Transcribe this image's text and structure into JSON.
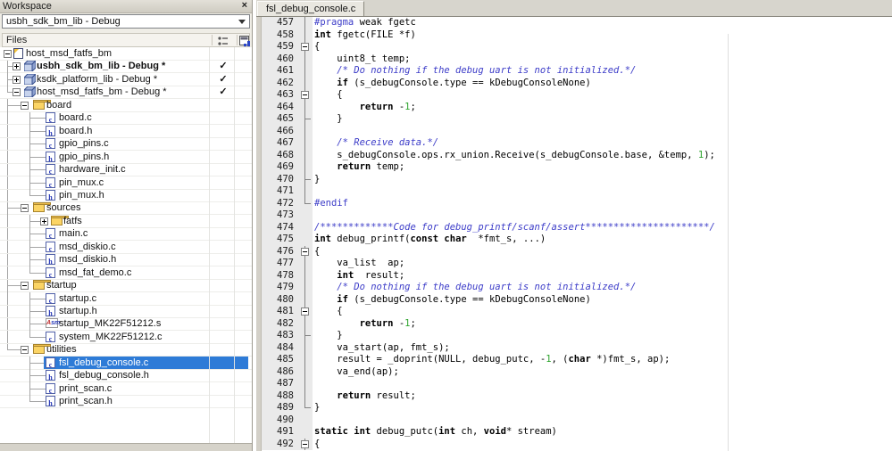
{
  "workspace": {
    "title": "Workspace",
    "close_label": "×",
    "config_selector": "usbh_sdk_bm_lib - Debug",
    "files_header": "Files",
    "header_icons": [
      "option-overrides-icon",
      "output-column-icon"
    ],
    "tree": [
      {
        "t": "root",
        "exp": "-",
        "icon": "root",
        "label": "host_msd_fatfs_bm"
      },
      {
        "t": "proj",
        "conn": "tee",
        "exp": "+",
        "icon": "proj",
        "label": "usbh_sdk_bm_lib - Debug *",
        "bold": true,
        "check": true
      },
      {
        "t": "proj",
        "conn": "tee",
        "exp": "+",
        "icon": "proj",
        "label": "ksdk_platform_lib - Debug *",
        "check": true
      },
      {
        "t": "proj",
        "conn": "elbow",
        "exp": "-",
        "icon": "proj",
        "label": "host_msd_fatfs_bm - Debug *",
        "check": true
      },
      {
        "t": "folder",
        "conn": "tee",
        "exp": "-",
        "icon": "folder",
        "label": "board"
      },
      {
        "t": "file",
        "conn": "tee",
        "g8": true,
        "icon": "c",
        "label": "board.c"
      },
      {
        "t": "file",
        "conn": "tee",
        "g8": true,
        "icon": "h",
        "label": "board.h"
      },
      {
        "t": "file",
        "conn": "tee",
        "g8": true,
        "icon": "c",
        "label": "gpio_pins.c"
      },
      {
        "t": "file",
        "conn": "tee",
        "g8": true,
        "icon": "h",
        "label": "gpio_pins.h"
      },
      {
        "t": "file",
        "conn": "tee",
        "g8": true,
        "icon": "c",
        "label": "hardware_init.c"
      },
      {
        "t": "file",
        "conn": "tee",
        "g8": true,
        "icon": "c",
        "label": "pin_mux.c"
      },
      {
        "t": "file",
        "conn": "elbow",
        "g8": true,
        "icon": "h",
        "label": "pin_mux.h"
      },
      {
        "t": "folder",
        "conn": "tee",
        "exp": "-",
        "icon": "folder",
        "label": "sources"
      },
      {
        "t": "ffolder",
        "conn": "tee",
        "g8": true,
        "exp": "+",
        "icon": "folder",
        "label": "fatfs"
      },
      {
        "t": "file",
        "conn": "tee",
        "g8": true,
        "icon": "c",
        "label": "main.c"
      },
      {
        "t": "file",
        "conn": "tee",
        "g8": true,
        "icon": "c",
        "label": "msd_diskio.c"
      },
      {
        "t": "file",
        "conn": "tee",
        "g8": true,
        "icon": "h",
        "label": "msd_diskio.h"
      },
      {
        "t": "file",
        "conn": "elbow",
        "g8": true,
        "icon": "c",
        "label": "msd_fat_demo.c"
      },
      {
        "t": "folder",
        "conn": "tee",
        "exp": "-",
        "icon": "folder",
        "label": "startup"
      },
      {
        "t": "file",
        "conn": "tee",
        "g8": true,
        "icon": "c",
        "label": "startup.c"
      },
      {
        "t": "file",
        "conn": "tee",
        "g8": true,
        "icon": "h",
        "label": "startup.h"
      },
      {
        "t": "file",
        "conn": "tee",
        "g8": true,
        "icon": "asm",
        "label": "startup_MK22F51212.s"
      },
      {
        "t": "file",
        "conn": "elbow",
        "g8": true,
        "icon": "c",
        "label": "system_MK22F51212.c"
      },
      {
        "t": "folder",
        "conn": "elbow",
        "exp": "-",
        "icon": "folder",
        "label": "utilities"
      },
      {
        "t": "file",
        "conn": "tee",
        "icon": "c",
        "label": "fsl_debug_console.c",
        "sel": true
      },
      {
        "t": "file",
        "conn": "tee",
        "icon": "h",
        "label": "fsl_debug_console.h"
      },
      {
        "t": "file",
        "conn": "tee",
        "icon": "c",
        "label": "print_scan.c"
      },
      {
        "t": "file",
        "conn": "elbow",
        "icon": "h",
        "label": "print_scan.h"
      }
    ],
    "checkmark_glyph": "✓"
  },
  "editor": {
    "tab": "fsl_debug_console.c",
    "lines": [
      {
        "n": 457,
        "f": "line",
        "s": [
          [
            "d",
            "#pragma"
          ],
          [
            "p",
            " weak fgetc"
          ]
        ]
      },
      {
        "n": 458,
        "f": "line",
        "s": [
          [
            "k",
            "int"
          ],
          [
            "p",
            " fgetc(FILE *f)"
          ]
        ]
      },
      {
        "n": 459,
        "f": "boxm",
        "s": [
          [
            "p",
            "{"
          ]
        ]
      },
      {
        "n": 460,
        "f": "line",
        "s": [
          [
            "p",
            "    uint8_t temp;"
          ]
        ]
      },
      {
        "n": 461,
        "f": "line",
        "s": [
          [
            "p",
            "    "
          ],
          [
            "c",
            "/* Do nothing if the debug uart is not initialized.*/"
          ]
        ]
      },
      {
        "n": 462,
        "f": "line",
        "s": [
          [
            "p",
            "    "
          ],
          [
            "k",
            "if"
          ],
          [
            "p",
            " (s_debugConsole.type == kDebugConsoleNone)"
          ]
        ]
      },
      {
        "n": 463,
        "f": "boxm",
        "s": [
          [
            "p",
            "    {"
          ]
        ]
      },
      {
        "n": 464,
        "f": "line",
        "s": [
          [
            "p",
            "        "
          ],
          [
            "k",
            "return"
          ],
          [
            "p",
            " -"
          ],
          [
            "n",
            "1"
          ],
          [
            "p",
            ";"
          ]
        ]
      },
      {
        "n": 465,
        "f": "tick",
        "s": [
          [
            "p",
            "    }"
          ]
        ]
      },
      {
        "n": 466,
        "f": "line",
        "s": []
      },
      {
        "n": 467,
        "f": "line",
        "s": [
          [
            "p",
            "    "
          ],
          [
            "c",
            "/* Receive data.*/"
          ]
        ]
      },
      {
        "n": 468,
        "f": "line",
        "s": [
          [
            "p",
            "    s_debugConsole.ops.rx_union.Receive(s_debugConsole.base, &temp, "
          ],
          [
            "n",
            "1"
          ],
          [
            "p",
            ");"
          ]
        ]
      },
      {
        "n": 469,
        "f": "line",
        "s": [
          [
            "p",
            "    "
          ],
          [
            "k",
            "return"
          ],
          [
            "p",
            " temp;"
          ]
        ]
      },
      {
        "n": 470,
        "f": "tick",
        "s": [
          [
            "p",
            "}"
          ]
        ]
      },
      {
        "n": 471,
        "f": "line",
        "s": []
      },
      {
        "n": 472,
        "f": "elbow",
        "s": [
          [
            "d",
            "#endif"
          ]
        ]
      },
      {
        "n": 473,
        "f": "none",
        "s": []
      },
      {
        "n": 474,
        "f": "none",
        "s": [
          [
            "c",
            "/*************Code for debug_printf/scanf/assert**********************/"
          ]
        ]
      },
      {
        "n": 475,
        "f": "none",
        "s": [
          [
            "k",
            "int"
          ],
          [
            "p",
            " debug_printf("
          ],
          [
            "k",
            "const"
          ],
          [
            "p",
            " "
          ],
          [
            "k",
            "char"
          ],
          [
            "p",
            "  *fmt_s, ...)"
          ]
        ]
      },
      {
        "n": 476,
        "f": "boxm",
        "s": [
          [
            "p",
            "{"
          ]
        ]
      },
      {
        "n": 477,
        "f": "line",
        "s": [
          [
            "p",
            "    va_list  ap;"
          ]
        ]
      },
      {
        "n": 478,
        "f": "line",
        "s": [
          [
            "p",
            "    "
          ],
          [
            "k",
            "int"
          ],
          [
            "p",
            "  result;"
          ]
        ]
      },
      {
        "n": 479,
        "f": "line",
        "s": [
          [
            "p",
            "    "
          ],
          [
            "c",
            "/* Do nothing if the debug uart is not initialized.*/"
          ]
        ]
      },
      {
        "n": 480,
        "f": "line",
        "s": [
          [
            "p",
            "    "
          ],
          [
            "k",
            "if"
          ],
          [
            "p",
            " (s_debugConsole.type == kDebugConsoleNone)"
          ]
        ]
      },
      {
        "n": 481,
        "f": "boxm",
        "s": [
          [
            "p",
            "    {"
          ]
        ]
      },
      {
        "n": 482,
        "f": "line",
        "s": [
          [
            "p",
            "        "
          ],
          [
            "k",
            "return"
          ],
          [
            "p",
            " -"
          ],
          [
            "n",
            "1"
          ],
          [
            "p",
            ";"
          ]
        ]
      },
      {
        "n": 483,
        "f": "tick",
        "s": [
          [
            "p",
            "    }"
          ]
        ]
      },
      {
        "n": 484,
        "f": "line",
        "s": [
          [
            "p",
            "    va_start(ap, fmt_s);"
          ]
        ]
      },
      {
        "n": 485,
        "f": "line",
        "s": [
          [
            "p",
            "    result = _doprint(NULL, debug_putc, -"
          ],
          [
            "n",
            "1"
          ],
          [
            "p",
            ", ("
          ],
          [
            "k",
            "char"
          ],
          [
            "p",
            " *)fmt_s, ap);"
          ]
        ]
      },
      {
        "n": 486,
        "f": "line",
        "s": [
          [
            "p",
            "    va_end(ap);"
          ]
        ]
      },
      {
        "n": 487,
        "f": "line",
        "s": []
      },
      {
        "n": 488,
        "f": "line",
        "s": [
          [
            "p",
            "    "
          ],
          [
            "k",
            "return"
          ],
          [
            "p",
            " result;"
          ]
        ]
      },
      {
        "n": 489,
        "f": "elbow",
        "s": [
          [
            "p",
            "}"
          ]
        ]
      },
      {
        "n": 490,
        "f": "none",
        "s": []
      },
      {
        "n": 491,
        "f": "none",
        "s": [
          [
            "k",
            "static"
          ],
          [
            "p",
            " "
          ],
          [
            "k",
            "int"
          ],
          [
            "p",
            " debug_putc("
          ],
          [
            "k",
            "int"
          ],
          [
            "p",
            " ch, "
          ],
          [
            "k",
            "void"
          ],
          [
            "p",
            "* stream)"
          ]
        ]
      },
      {
        "n": 492,
        "f": "boxm",
        "s": [
          [
            "p",
            "{"
          ]
        ]
      }
    ]
  },
  "colors": {
    "selection": "#2E7BD7",
    "comment": "#3C3CC8",
    "preprocessor": "#3C3CC8",
    "number": "#2DA42D",
    "keyword": "#000000",
    "gutter": "#EAEAEA",
    "folder_yellow": "#FBD465"
  }
}
